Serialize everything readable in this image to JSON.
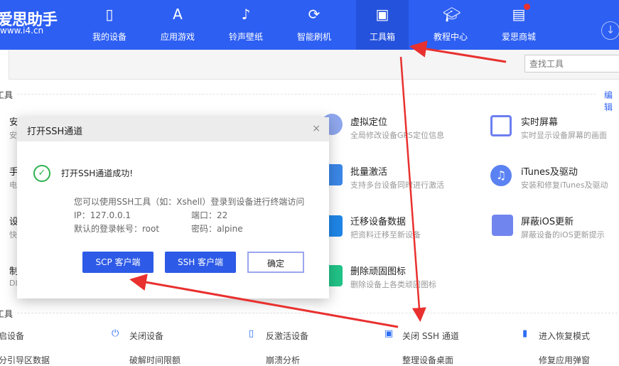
{
  "app": {
    "logo": "爱思助手",
    "url": "www.i4.cn"
  },
  "nav": [
    {
      "label": "我的设备",
      "icon": "phone-icon"
    },
    {
      "label": "应用游戏",
      "icon": "app-store-icon"
    },
    {
      "label": "铃声壁纸",
      "icon": "ringtone-icon"
    },
    {
      "label": "智能刷机",
      "icon": "flash-icon"
    },
    {
      "label": "工具箱",
      "icon": "toolbox-icon",
      "active": true
    },
    {
      "label": "教程中心",
      "icon": "tutorial-icon"
    },
    {
      "label": "爱思商城",
      "icon": "store-icon"
    }
  ],
  "search": {
    "placeholder": "查找工具"
  },
  "section1": {
    "title": "工具",
    "edit": "编辑"
  },
  "tools": [
    {
      "title": "安",
      "desc": "安"
    },
    {
      "title": "手",
      "desc": "电"
    },
    {
      "title": "设",
      "desc": "快"
    },
    {
      "title": "制",
      "desc": "DI"
    },
    {
      "title": "虚拟定位",
      "desc": "全局修改设备GPS定位信息"
    },
    {
      "title": "批量激活",
      "desc": "支持多台设备同时进行激活"
    },
    {
      "title": "迁移设备数据",
      "desc": "把资料迁移至新设备"
    },
    {
      "title": "删除顽固图标",
      "desc": "删除设备上各类顽固图标"
    },
    {
      "title": "实时屏幕",
      "desc": "实时显示设备屏幕的画面"
    },
    {
      "title": "iTunes及驱动",
      "desc": "安装和修复iTunes及驱动"
    },
    {
      "title": "屏蔽iOS更新",
      "desc": "屏蔽设备的iOS更新提示"
    }
  ],
  "section2": {
    "title": "工具"
  },
  "quick": [
    {
      "label": "启设备",
      "icon": ""
    },
    {
      "label": "关闭设备",
      "icon": "⏻"
    },
    {
      "label": "反激活设备",
      "icon": "▯"
    },
    {
      "label": "关闭 SSH 通道",
      "icon": "▣"
    },
    {
      "label": "进入恢复模式",
      "icon": "▮"
    }
  ],
  "quick2": [
    "分引导区数据",
    "破解时间限额",
    "崩溃分析",
    "整理设备桌面",
    "修复应用弹窗"
  ],
  "dialog": {
    "title": "打开SSH通道",
    "close": "×",
    "success": "打开SSH通道成功!",
    "hint": "您可以使用SSH工具（如：Xshell）登录到设备进行终端访问",
    "ip_label": "IP：127.0.0.1",
    "port_label": "端口：22",
    "account_label": "默认的登录帐号：root",
    "password_label": "密码：alpine",
    "scp": "SCP 客户端",
    "ssh": "SSH 客户端",
    "ok": "确定"
  },
  "colors": {
    "brand": "#2d5ff3",
    "arrow": "#e8312f",
    "success": "#2eb24f"
  }
}
